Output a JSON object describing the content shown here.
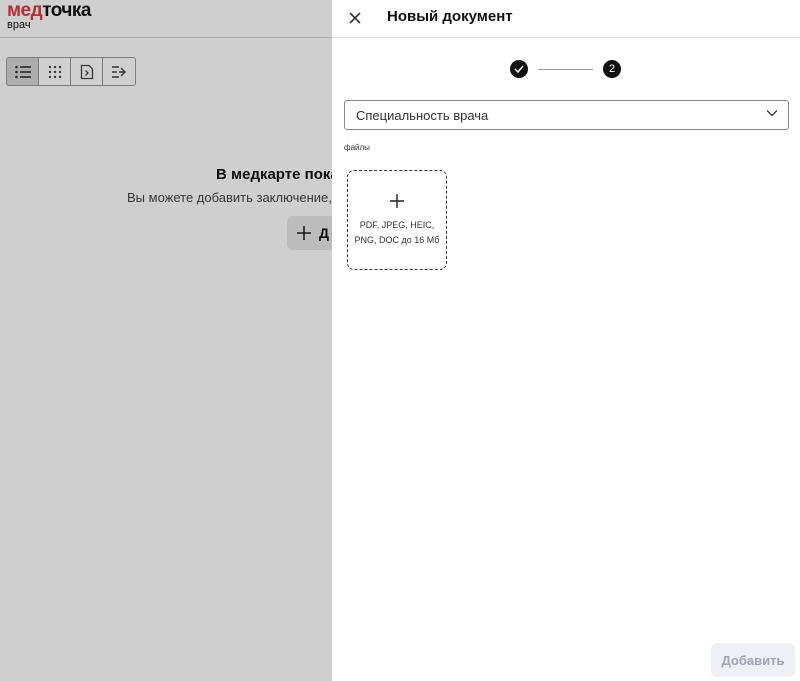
{
  "app": {
    "logo_part1": "мед",
    "logo_part2": "точка",
    "logo_sub": "врач"
  },
  "view_switch": {
    "buttons": [
      {
        "icon": "list-icon",
        "active": true
      },
      {
        "icon": "grid-icon",
        "active": false
      },
      {
        "icon": "document-icon",
        "active": false
      },
      {
        "icon": "filter-icon",
        "active": false
      }
    ]
  },
  "empty_state": {
    "title": "В медкарте пока",
    "subtitle": "Вы можете добавить заключение, р",
    "add_button_label": "Д"
  },
  "drawer": {
    "title": "Новый документ",
    "stepper": {
      "steps": [
        {
          "state": "done",
          "label": ""
        },
        {
          "state": "current",
          "label": "2"
        }
      ]
    },
    "specialty_select": {
      "placeholder": "Специальность врача"
    },
    "files_label": "файлы",
    "upload": {
      "hint": "PDF, JPEG, HEIC, PNG, DOC до 16 Мб"
    },
    "submit_label": "Добавить"
  },
  "colors": {
    "brand_red": "#e0383e",
    "submit_disabled_text": "#9aa6b8",
    "submit_disabled_bg": "#edf0f4"
  }
}
